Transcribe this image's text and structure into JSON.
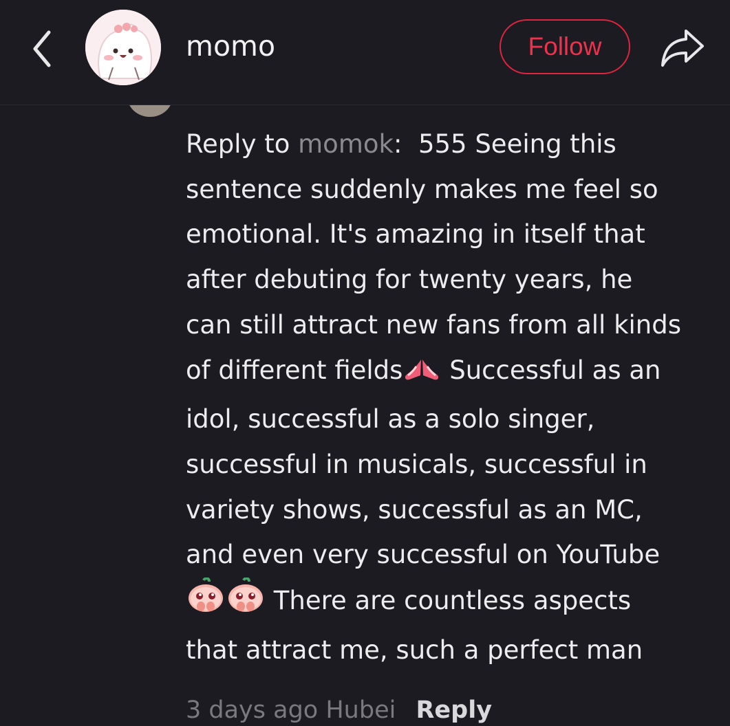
{
  "header": {
    "username": "momo",
    "follow_label": "Follow"
  },
  "comment": {
    "reply_prefix": "Reply to ",
    "mention": "momok",
    "colon": ":  ",
    "text_part1": "555 Seeing this\nsentence suddenly makes me feel so\nemotional. It's amazing in itself that\nafter debuting for twenty years, he\ncan still attract new fans from all kinds\nof different fields",
    "text_part2": " Successful as an\nidol, successful as a solo singer,\nsuccessful in musicals, successful in\nvariety shows, successful as an MC,\nand even very successful on YouTube\n",
    "text_part3": " There are countless aspects\nthat attract me, such a perfect man",
    "emojis": [
      "praying-hands-emoji",
      "pleading-peach-emoji",
      "pleading-peach-emoji"
    ]
  },
  "meta": {
    "time": "3 days ago",
    "location": "Hubei",
    "reply_label": "Reply"
  },
  "colors": {
    "background": "#1c1b21",
    "accent": "#e1243f",
    "mention": "#8b8a91"
  }
}
